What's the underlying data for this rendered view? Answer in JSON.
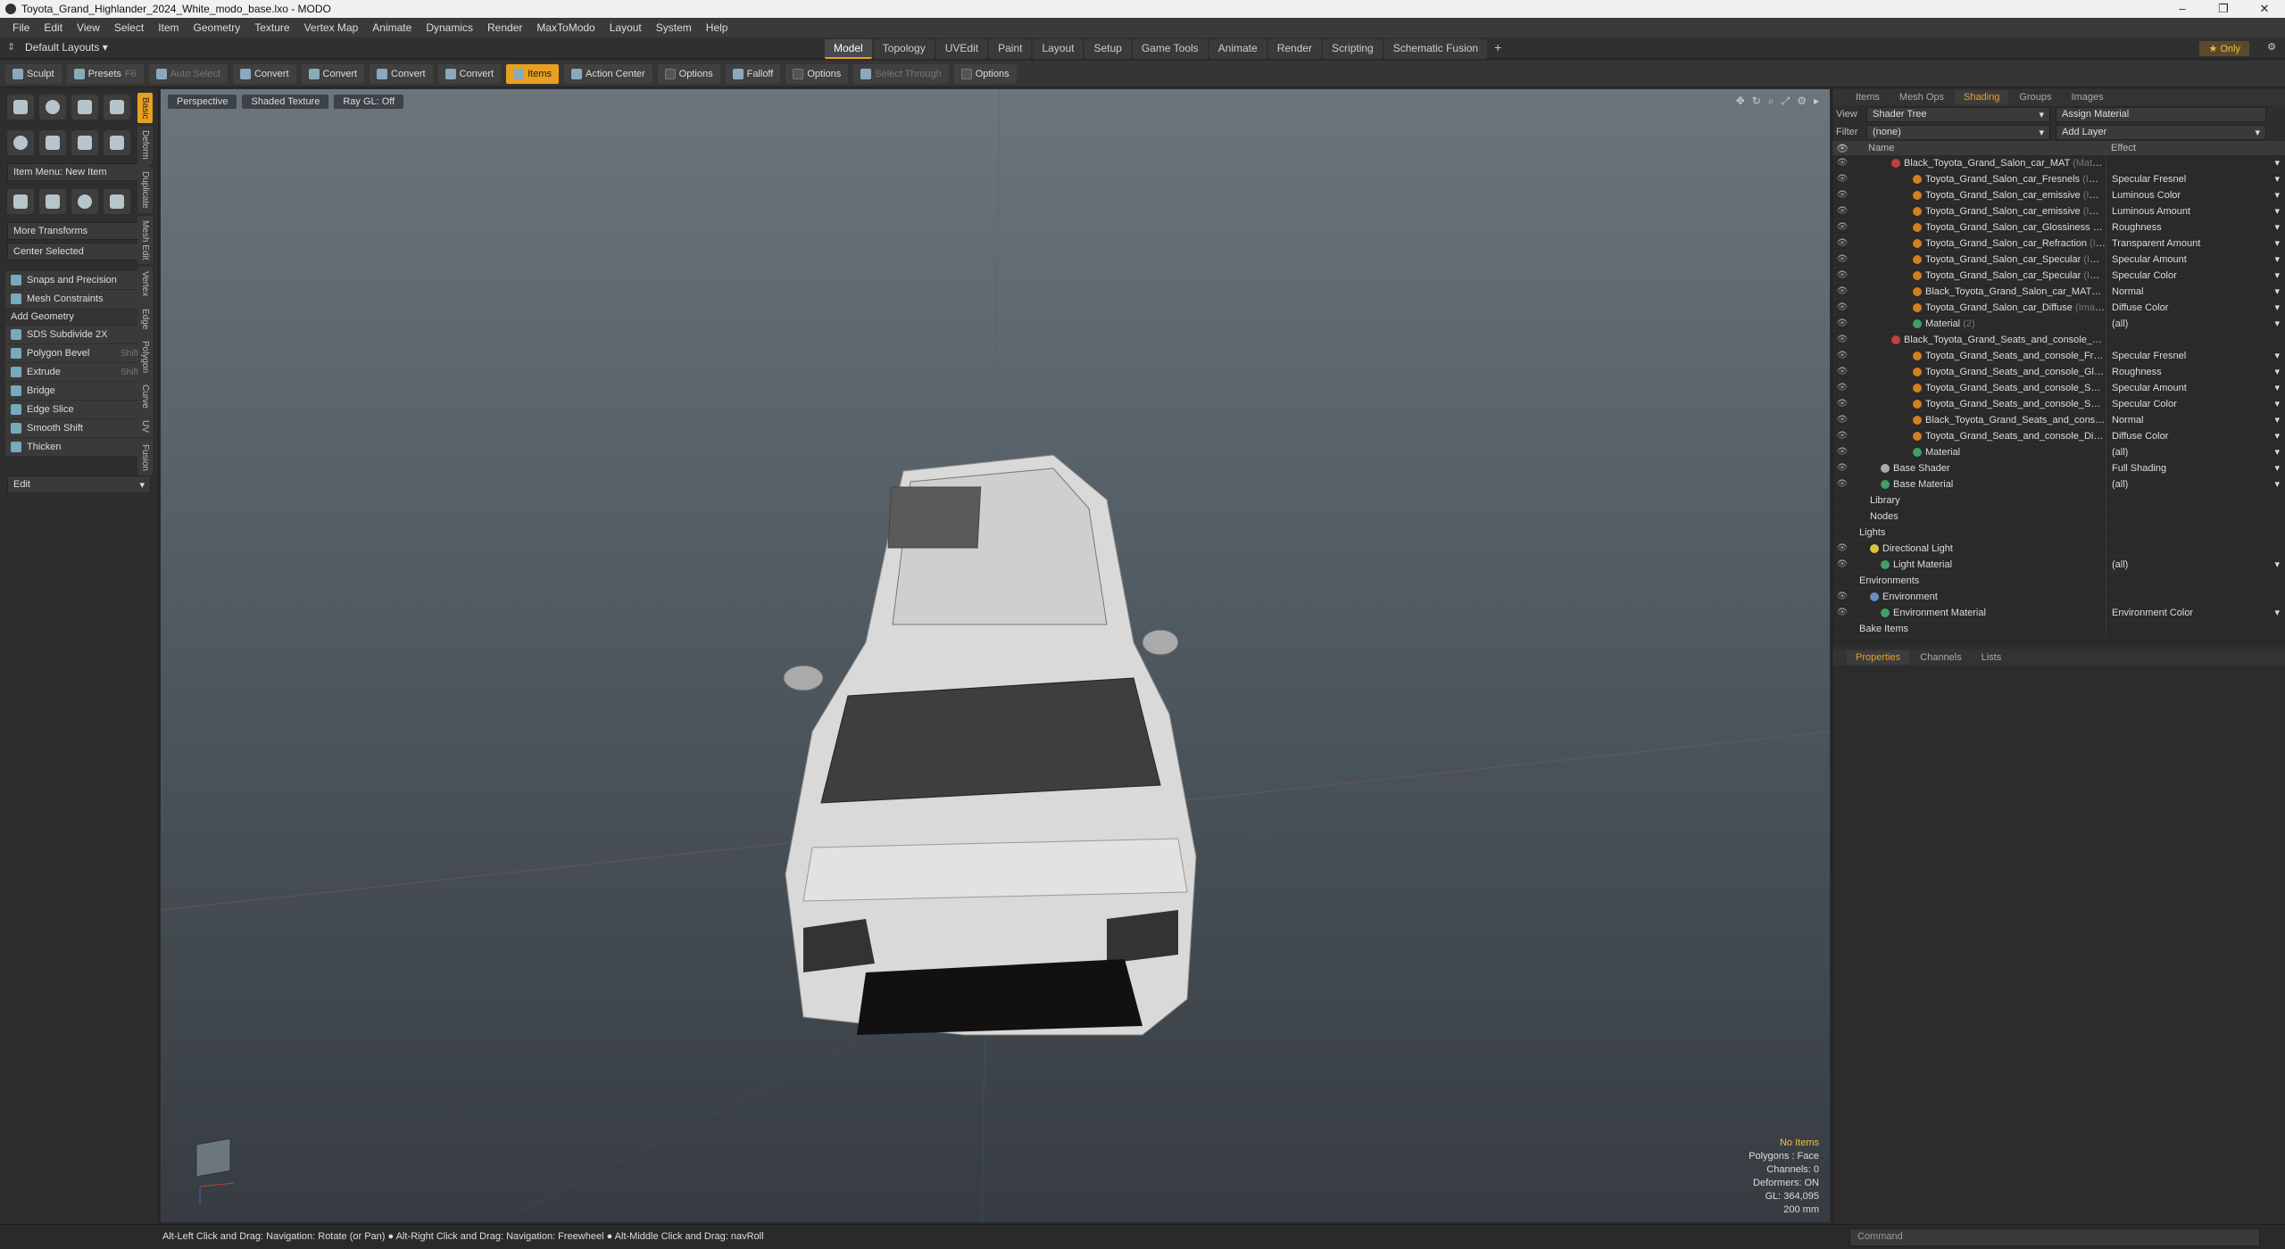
{
  "window": {
    "title": "Toyota_Grand_Highlander_2024_White_modo_base.lxo - MODO"
  },
  "menu": [
    "File",
    "Edit",
    "View",
    "Select",
    "Item",
    "Geometry",
    "Texture",
    "Vertex Map",
    "Animate",
    "Dynamics",
    "Render",
    "MaxToModo",
    "Layout",
    "System",
    "Help"
  ],
  "layout": {
    "default": "Default Layouts ▾",
    "tabs": [
      "Model",
      "Topology",
      "UVEdit",
      "Paint",
      "Layout",
      "Setup",
      "Game Tools",
      "Animate",
      "Render",
      "Scripting",
      "Schematic Fusion"
    ],
    "only": "★ Only"
  },
  "toolbar": {
    "sculpt": "Sculpt",
    "presets": "Presets",
    "presets_key": "F6",
    "auto_select": "Auto Select",
    "convert": "Convert",
    "items": "Items",
    "action_center": "Action Center",
    "options": "Options",
    "falloff": "Falloff",
    "select_through": "Select Through"
  },
  "left": {
    "item_menu": "Item Menu: New Item",
    "more_transforms": "More Transforms",
    "center_selected": "Center Selected",
    "snaps": "Snaps and Precision",
    "mesh_constraints": "Mesh Constraints",
    "add_geometry": "Add Geometry",
    "tools": [
      {
        "label": "SDS Subdivide 2X",
        "key": ""
      },
      {
        "label": "Polygon Bevel",
        "key": "Shift-B"
      },
      {
        "label": "Extrude",
        "key": "Shift-X"
      },
      {
        "label": "Bridge",
        "key": ""
      },
      {
        "label": "Edge Slice",
        "key": ""
      },
      {
        "label": "Smooth Shift",
        "key": ""
      },
      {
        "label": "Thicken",
        "key": ""
      }
    ],
    "edit": "Edit",
    "vtabs": [
      "Basic",
      "Deform",
      "Duplicate",
      "Mesh Edit",
      "Vertex",
      "Edge",
      "Polygon",
      "Curve",
      "UV",
      "Fusion"
    ]
  },
  "viewport": {
    "perspective": "Perspective",
    "shading": "Shaded Texture",
    "raygl": "Ray GL: Off",
    "info": {
      "items": "No Items",
      "polygons": "Polygons : Face",
      "channels": "Channels: 0",
      "deformers": "Deformers: ON",
      "gl": "GL: 364,095",
      "size": "200 mm"
    }
  },
  "right": {
    "tabs": [
      "Items",
      "Mesh Ops",
      "Shading",
      "Groups",
      "Images"
    ],
    "view_label": "View",
    "view_value": "Shader Tree",
    "assign": "Assign Material",
    "filter_label": "Filter",
    "filter_value": "(none)",
    "add_layer": "Add Layer",
    "col_name": "Name",
    "col_effect": "Effect",
    "rows": [
      {
        "name": "Black_Toyota_Grand_Salon_car_MAT",
        "type": "(Material)",
        "effect": "",
        "color": "#c04040"
      },
      {
        "name": "Toyota_Grand_Salon_car_Fresnels",
        "type": "(Image)",
        "effect": "Specular Fresnel",
        "color": "#d08020"
      },
      {
        "name": "Toyota_Grand_Salon_car_emissive",
        "type": "(Image)",
        "effect": "Luminous Color",
        "color": "#d08020"
      },
      {
        "name": "Toyota_Grand_Salon_car_emissive",
        "type": "(Image)",
        "effect": "Luminous Amount",
        "color": "#d08020"
      },
      {
        "name": "Toyota_Grand_Salon_car_Glossiness",
        "type": "(Image)",
        "effect": "Roughness",
        "color": "#d08020"
      },
      {
        "name": "Toyota_Grand_Salon_car_Refraction",
        "type": "(Image)",
        "effect": "Transparent Amount",
        "color": "#d08020"
      },
      {
        "name": "Toyota_Grand_Salon_car_Specular",
        "type": "(Image)",
        "effect": "Specular Amount",
        "color": "#d08020"
      },
      {
        "name": "Toyota_Grand_Salon_car_Specular",
        "type": "(Image)",
        "effect": "Specular Color",
        "color": "#d08020"
      },
      {
        "name": "Black_Toyota_Grand_Salon_car_MAT_bump ...",
        "type": "",
        "effect": "Normal",
        "color": "#d08020"
      },
      {
        "name": "Toyota_Grand_Salon_car_Diffuse",
        "type": "(Image)",
        "effect": "Diffuse Color",
        "color": "#d08020"
      },
      {
        "name": "Material",
        "type": "(2)",
        "effect": "(all)",
        "color": "#40a060"
      },
      {
        "name": "Black_Toyota_Grand_Seats_and_console_MAT...",
        "type": "",
        "effect": "",
        "color": "#c04040"
      },
      {
        "name": "Toyota_Grand_Seats_and_console_Fresnel",
        "type": "",
        "effect": "Specular Fresnel",
        "color": "#d08020"
      },
      {
        "name": "Toyota_Grand_Seats_and_console_Glossine...",
        "type": "",
        "effect": "Roughness",
        "color": "#d08020"
      },
      {
        "name": "Toyota_Grand_Seats_and_console_Specula ...",
        "type": "",
        "effect": "Specular Amount",
        "color": "#d08020"
      },
      {
        "name": "Toyota_Grand_Seats_and_console_Specula ...",
        "type": "",
        "effect": "Specular Color",
        "color": "#d08020"
      },
      {
        "name": "Black_Toyota_Grand_Seats_and_console_M...",
        "type": "",
        "effect": "Normal",
        "color": "#d08020"
      },
      {
        "name": "Toyota_Grand_Seats_and_console_Diffuse",
        "type": "",
        "effect": "Diffuse Color",
        "color": "#d08020"
      },
      {
        "name": "Material",
        "type": "",
        "effect": "(all)",
        "color": "#40a060"
      },
      {
        "name": "Base Shader",
        "type": "",
        "effect": "Full Shading",
        "color": "#aaaaaa"
      },
      {
        "name": "Base Material",
        "type": "",
        "effect": "(all)",
        "color": "#40a060"
      },
      {
        "name": "Library",
        "type": "",
        "effect": "",
        "color": ""
      },
      {
        "name": "Nodes",
        "type": "",
        "effect": "",
        "color": ""
      },
      {
        "name": "Lights",
        "type": "",
        "effect": "",
        "color": ""
      },
      {
        "name": "Directional Light",
        "type": "",
        "effect": "",
        "color": "#e0c040"
      },
      {
        "name": "Light Material",
        "type": "",
        "effect": "(all)",
        "color": "#40a060"
      },
      {
        "name": "Environments",
        "type": "",
        "effect": "",
        "color": ""
      },
      {
        "name": "Environment",
        "type": "",
        "effect": "",
        "color": "#6090c0"
      },
      {
        "name": "Environment Material",
        "type": "",
        "effect": "Environment Color",
        "color": "#40a060"
      },
      {
        "name": "Bake Items",
        "type": "",
        "effect": "",
        "color": ""
      }
    ],
    "prop_tabs": [
      "Properties",
      "Channels",
      "Lists"
    ]
  },
  "status": {
    "hint": "Alt-Left Click and Drag: Navigation: Rotate (or Pan) ● Alt-Right Click and Drag: Navigation: Freewheel ● Alt-Middle Click and Drag: navRoll",
    "command": "Command"
  }
}
